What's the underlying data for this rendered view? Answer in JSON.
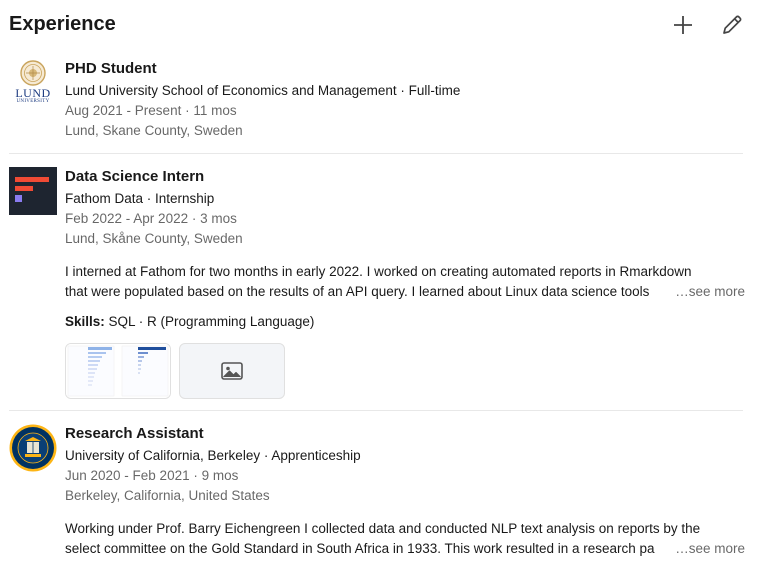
{
  "section": {
    "title": "Experience",
    "add_icon": "plus-icon",
    "edit_icon": "pencil-icon"
  },
  "entries": [
    {
      "title": "PHD Student",
      "org_line": "Lund University School of Economics and Management · Full-time",
      "dates": "Aug 2021 - Present · 11 mos",
      "location": "Lund, Skane County, Sweden",
      "logo": {
        "icon": "lund-university-logo",
        "wordmark_1": "LUND",
        "wordmark_2": "UNIVERSITY"
      }
    },
    {
      "title": "Data Science Intern",
      "org_line": "Fathom Data · Internship",
      "dates": "Feb 2022 - Apr 2022 · 3 mos",
      "location": "Lund, Skåne County, Sweden",
      "logo": {
        "icon": "fathom-data-logo"
      },
      "description_line_1": "I interned at Fathom for two months in early 2022. I worked on creating automated reports in Rmarkdown",
      "description_line_2": "that were populated based on the results of an API query. I learned about Linux data science tools",
      "see_more": "…see more",
      "skills_label": "Skills:",
      "skills": "SQL · R (Programming Language)",
      "media_icons": [
        "chart-thumbnail",
        "image-placeholder-icon"
      ]
    },
    {
      "title": "Research Assistant",
      "org_line": "University of California, Berkeley · Apprenticeship",
      "dates": "Jun 2020 - Feb 2021 · 9 mos",
      "location": "Berkeley, California, United States",
      "logo": {
        "icon": "uc-berkeley-seal-logo"
      },
      "description_line_1": "Working under Prof. Barry Eichengreen I collected data and conducted NLP text analysis on reports by the",
      "description_line_2": "select committee on the Gold Standard in South Africa in 1933. This work resulted in a research pa",
      "see_more": "…see more"
    }
  ],
  "colors": {
    "text": "#191919",
    "muted": "#666666",
    "divider": "#e8e8e8",
    "lund_blue": "#1c3b80",
    "lund_gold": "#c9a45c",
    "fathom_bg": "#1e2530",
    "fathom_red": "#f04b35",
    "fathom_purple": "#8a7cf0",
    "berkeley_navy": "#003262",
    "berkeley_gold": "#fdb515"
  }
}
